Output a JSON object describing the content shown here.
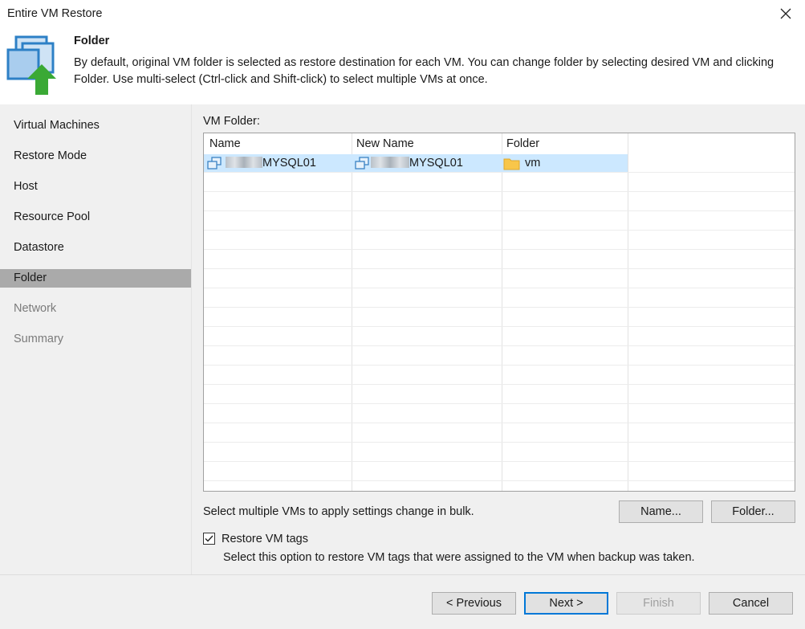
{
  "window": {
    "title": "Entire VM Restore"
  },
  "header": {
    "title": "Folder",
    "description": "By default, original VM folder is selected as restore destination for each VM. You can change folder by selecting desired VM and clicking Folder. Use multi-select (Ctrl-click and Shift-click) to select multiple VMs at once."
  },
  "sidebar": {
    "items": [
      {
        "label": "Virtual Machines",
        "state": "normal"
      },
      {
        "label": "Restore Mode",
        "state": "normal"
      },
      {
        "label": "Host",
        "state": "normal"
      },
      {
        "label": "Resource Pool",
        "state": "normal"
      },
      {
        "label": "Datastore",
        "state": "normal"
      },
      {
        "label": "Folder",
        "state": "active"
      },
      {
        "label": "Network",
        "state": "disabled"
      },
      {
        "label": "Summary",
        "state": "disabled"
      }
    ]
  },
  "main": {
    "vm_folder_label": "VM Folder:",
    "columns": [
      "Name",
      "New Name",
      "Folder"
    ],
    "rows": [
      {
        "name": "MYSQL01",
        "new_name": "MYSQL01",
        "folder": "vm",
        "selected": true
      }
    ],
    "bulk_hint": "Select multiple VMs to apply settings change in bulk.",
    "name_button": "Name...",
    "folder_button": "Folder...",
    "restore_tags_label": "Restore VM tags",
    "restore_tags_checked": true,
    "restore_tags_hint": "Select this option to restore VM tags that were assigned to the VM when backup was taken."
  },
  "footer": {
    "previous": "< Previous",
    "next": "Next >",
    "finish": "Finish",
    "cancel": "Cancel"
  },
  "colors": {
    "sidebar_bg": "#f0f0f0",
    "active_item": "#aaaaaa",
    "selection": "#cce8ff",
    "folder_icon": "#f8c64a",
    "arrow_green": "#3aa935",
    "primary_border": "#0078d7"
  }
}
